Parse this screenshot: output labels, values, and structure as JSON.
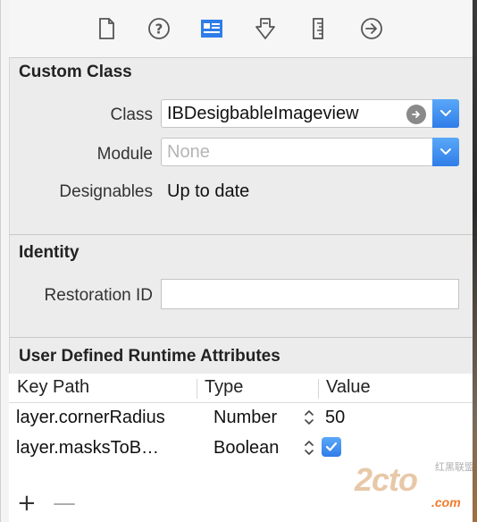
{
  "toolbar": {
    "icons": [
      "file-icon",
      "help-icon",
      "identity-inspector-icon",
      "attributes-icon",
      "size-ruler-icon",
      "connections-arrow-icon"
    ],
    "active_color": "#2f7de8"
  },
  "custom_class": {
    "title": "Custom Class",
    "class_label": "Class",
    "class_value": "IBDesigbableImageview",
    "module_label": "Module",
    "module_placeholder": "None",
    "designables_label": "Designables",
    "designables_value": "Up to date"
  },
  "identity": {
    "title": "Identity",
    "restoration_id_label": "Restoration ID",
    "restoration_id_value": ""
  },
  "runtime_attributes": {
    "title": "User Defined Runtime Attributes",
    "columns": [
      "Key Path",
      "Type",
      "Value"
    ],
    "rows": [
      {
        "key_path": "layer.cornerRadius",
        "type": "Number",
        "value": "50"
      },
      {
        "key_path": "layer.masksToB…",
        "type": "Boolean",
        "value": "checked"
      }
    ],
    "add_label": "+",
    "remove_label": "—"
  },
  "watermark": {
    "main": "2cto",
    "sub": "红黑联盟",
    "url": ".com"
  }
}
